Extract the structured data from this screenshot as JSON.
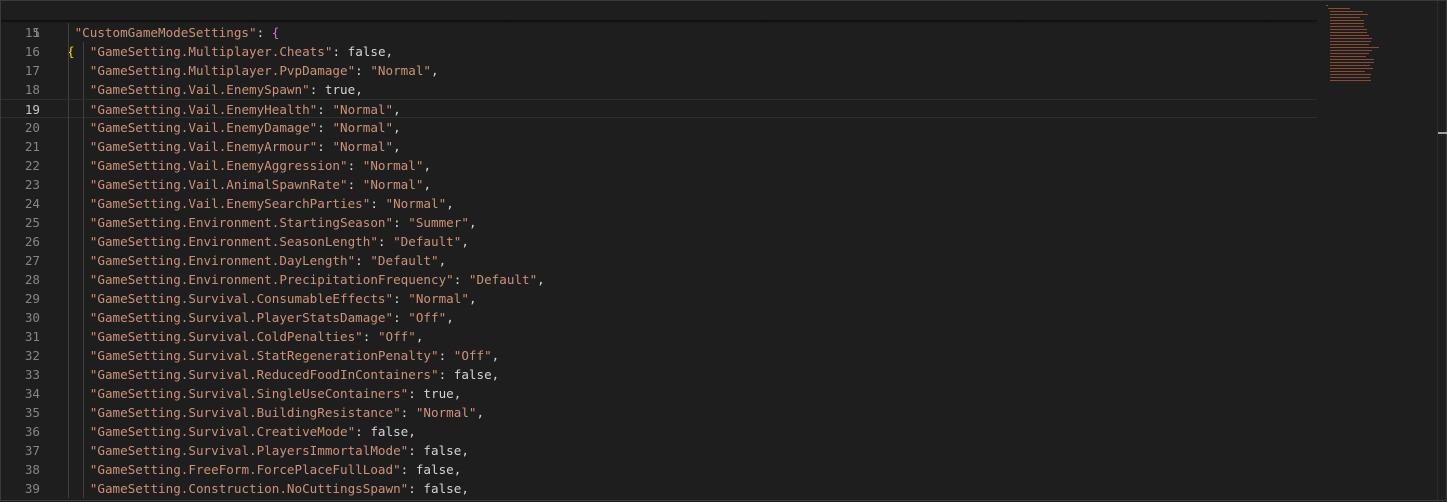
{
  "editor": {
    "sticky_line": {
      "number": "1",
      "text": "{"
    },
    "current_line": "19",
    "lines": [
      {
        "number": "15",
        "key": "\"CustomGameModeSettings\"",
        "sep": ": ",
        "value": "{",
        "kind": "brace",
        "indent": 1
      },
      {
        "number": "16",
        "key": "\"GameSetting.Multiplayer.Cheats\"",
        "sep": ": ",
        "value": "false,",
        "kind": "bool",
        "indent": 2
      },
      {
        "number": "17",
        "key": "\"GameSetting.Multiplayer.PvpDamage\"",
        "sep": ": ",
        "value": "\"Normal\"",
        "tail": ",",
        "kind": "str",
        "indent": 2
      },
      {
        "number": "18",
        "key": "\"GameSetting.Vail.EnemySpawn\"",
        "sep": ": ",
        "value": "true,",
        "kind": "bool",
        "indent": 2
      },
      {
        "number": "19",
        "key": "\"GameSetting.Vail.EnemyHealth\"",
        "sep": ": ",
        "value": "\"Normal\"",
        "tail": ",",
        "kind": "str",
        "indent": 2
      },
      {
        "number": "20",
        "key": "\"GameSetting.Vail.EnemyDamage\"",
        "sep": ": ",
        "value": "\"Normal\"",
        "tail": ",",
        "kind": "str",
        "indent": 2
      },
      {
        "number": "21",
        "key": "\"GameSetting.Vail.EnemyArmour\"",
        "sep": ": ",
        "value": "\"Normal\"",
        "tail": ",",
        "kind": "str",
        "indent": 2
      },
      {
        "number": "22",
        "key": "\"GameSetting.Vail.EnemyAggression\"",
        "sep": ": ",
        "value": "\"Normal\"",
        "tail": ",",
        "kind": "str",
        "indent": 2
      },
      {
        "number": "23",
        "key": "\"GameSetting.Vail.AnimalSpawnRate\"",
        "sep": ": ",
        "value": "\"Normal\"",
        "tail": ",",
        "kind": "str",
        "indent": 2
      },
      {
        "number": "24",
        "key": "\"GameSetting.Vail.EnemySearchParties\"",
        "sep": ": ",
        "value": "\"Normal\"",
        "tail": ",",
        "kind": "str",
        "indent": 2
      },
      {
        "number": "25",
        "key": "\"GameSetting.Environment.StartingSeason\"",
        "sep": ": ",
        "value": "\"Summer\"",
        "tail": ",",
        "kind": "str",
        "indent": 2
      },
      {
        "number": "26",
        "key": "\"GameSetting.Environment.SeasonLength\"",
        "sep": ": ",
        "value": "\"Default\"",
        "tail": ",",
        "kind": "str",
        "indent": 2
      },
      {
        "number": "27",
        "key": "\"GameSetting.Environment.DayLength\"",
        "sep": ": ",
        "value": "\"Default\"",
        "tail": ",",
        "kind": "str",
        "indent": 2
      },
      {
        "number": "28",
        "key": "\"GameSetting.Environment.PrecipitationFrequency\"",
        "sep": ": ",
        "value": "\"Default\"",
        "tail": ",",
        "kind": "str",
        "indent": 2
      },
      {
        "number": "29",
        "key": "\"GameSetting.Survival.ConsumableEffects\"",
        "sep": ": ",
        "value": "\"Normal\"",
        "tail": ",",
        "kind": "str",
        "indent": 2
      },
      {
        "number": "30",
        "key": "\"GameSetting.Survival.PlayerStatsDamage\"",
        "sep": ": ",
        "value": "\"Off\"",
        "tail": ",",
        "kind": "str",
        "indent": 2
      },
      {
        "number": "31",
        "key": "\"GameSetting.Survival.ColdPenalties\"",
        "sep": ": ",
        "value": "\"Off\"",
        "tail": ",",
        "kind": "str",
        "indent": 2
      },
      {
        "number": "32",
        "key": "\"GameSetting.Survival.StatRegenerationPenalty\"",
        "sep": ": ",
        "value": "\"Off\"",
        "tail": ",",
        "kind": "str",
        "indent": 2
      },
      {
        "number": "33",
        "key": "\"GameSetting.Survival.ReducedFoodInContainers\"",
        "sep": ": ",
        "value": "false,",
        "kind": "bool",
        "indent": 2
      },
      {
        "number": "34",
        "key": "\"GameSetting.Survival.SingleUseContainers\"",
        "sep": ": ",
        "value": "true,",
        "kind": "bool",
        "indent": 2
      },
      {
        "number": "35",
        "key": "\"GameSetting.Survival.BuildingResistance\"",
        "sep": ": ",
        "value": "\"Normal\"",
        "tail": ",",
        "kind": "str",
        "indent": 2
      },
      {
        "number": "36",
        "key": "\"GameSetting.Survival.CreativeMode\"",
        "sep": ": ",
        "value": "false,",
        "kind": "bool",
        "indent": 2
      },
      {
        "number": "37",
        "key": "\"GameSetting.Survival.PlayersImmortalMode\"",
        "sep": ": ",
        "value": "false,",
        "kind": "bool",
        "indent": 2
      },
      {
        "number": "38",
        "key": "\"GameSetting.FreeForm.ForcePlaceFullLoad\"",
        "sep": ": ",
        "value": "false,",
        "kind": "bool",
        "indent": 2
      },
      {
        "number": "39",
        "key": "\"GameSetting.Construction.NoCuttingsSpawn\"",
        "sep": ": ",
        "value": "false,",
        "kind": "bool",
        "indent": 2
      }
    ]
  },
  "colors": {
    "background": "#1e1e1e",
    "line_number": "#858585",
    "string": "#ce9178",
    "punctuation": "#d4d4d4",
    "brace_level_1": "#ffd700",
    "brace_level_2": "#da70d6"
  }
}
